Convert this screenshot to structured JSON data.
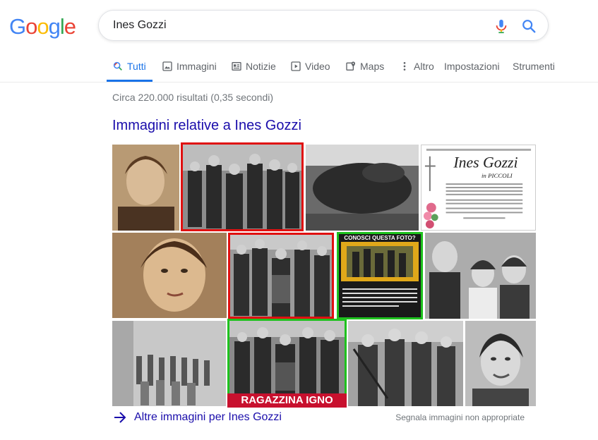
{
  "logo": {
    "letters": [
      "G",
      "o",
      "o",
      "g",
      "l",
      "e"
    ]
  },
  "search": {
    "value": "Ines Gozzi"
  },
  "tabs": [
    {
      "label": "Tutti",
      "icon": "search-icon",
      "active": true
    },
    {
      "label": "Immagini",
      "icon": "image-icon"
    },
    {
      "label": "Notizie",
      "icon": "news-icon"
    },
    {
      "label": "Video",
      "icon": "play-icon"
    },
    {
      "label": "Maps",
      "icon": "map-pin-icon"
    },
    {
      "label": "Altro",
      "icon": "more-vert-icon"
    },
    {
      "label": "Impostazioni"
    },
    {
      "label": "Strumenti"
    }
  ],
  "results": {
    "stats": "Circa 220.000 risultati (0,35 secondi)",
    "images_heading": "Immagini relative a Ines Gozzi",
    "more_images": "Altre immagini per Ines Gozzi",
    "report": "Segnala immagini non appropriate"
  },
  "images": {
    "obituary_name": "Ines Gozzi",
    "obituary_sub": "in PICCOLI",
    "quiz_banner": "CONOSCI QUESTA FOTO?",
    "caption": "RAGAZZINA IGNO"
  },
  "colors": {
    "blue": "#4285f4",
    "red": "#ea4335",
    "yellow": "#fbbc05",
    "green": "#34a853",
    "link": "#1a0dab",
    "active_tab": "#1a73e8",
    "box_red": "#e01010",
    "box_green": "#1ec21e"
  }
}
